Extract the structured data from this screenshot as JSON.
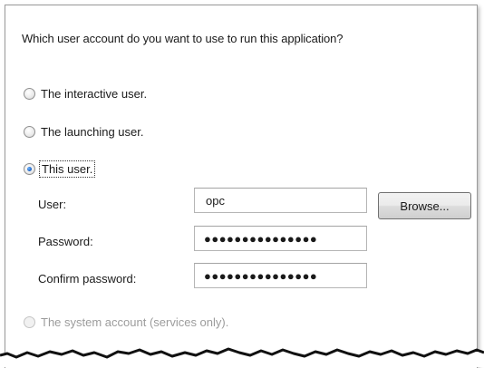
{
  "question": "Which user account do you want to use to run this application?",
  "options": {
    "interactive": {
      "label": "The interactive user.",
      "selected": false,
      "enabled": true
    },
    "launching": {
      "label": "The launching user.",
      "selected": false,
      "enabled": true
    },
    "this_user": {
      "label": "This user.",
      "selected": true,
      "enabled": true
    },
    "system": {
      "label": "The system account (services only).",
      "selected": false,
      "enabled": false
    }
  },
  "fields": {
    "user_label": "User:",
    "user_value": "opc",
    "password_label": "Password:",
    "password_value": "●●●●●●●●●●●●●●●",
    "confirm_label": "Confirm password:",
    "confirm_value": "●●●●●●●●●●●●●●●"
  },
  "buttons": {
    "browse_label": "Browse..."
  }
}
